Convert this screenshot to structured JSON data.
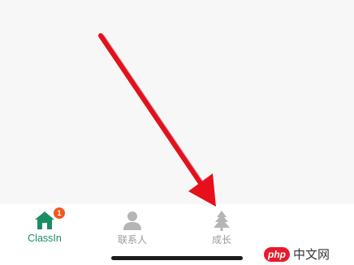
{
  "tab_bar": {
    "tabs": [
      {
        "label": "ClassIn",
        "icon": "home-icon",
        "active": true,
        "badge": "1"
      },
      {
        "label": "联系人",
        "icon": "person-icon",
        "active": false
      },
      {
        "label": "成长",
        "icon": "tree-icon",
        "active": false
      }
    ]
  },
  "colors": {
    "active": "#1a8e63",
    "inactive": "#b5b5b5",
    "badge": "#f05a22",
    "arrow": "#e5101b"
  },
  "watermark": {
    "logo": "php",
    "text": "中文网"
  }
}
